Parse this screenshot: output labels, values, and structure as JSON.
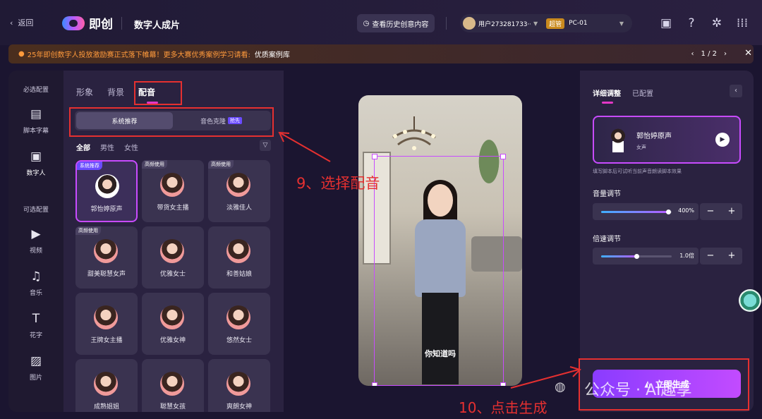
{
  "topbar": {
    "back_label": "返回",
    "logo_text": "即创",
    "page_title": "数字人成片",
    "history_button": "查看历史创意内容",
    "user": "用户273281733···",
    "super_badge": "超管",
    "device": "PC-01",
    "icons": [
      "wallet-icon",
      "help-icon",
      "settings-icon",
      "grid-icon"
    ]
  },
  "notice": {
    "text": "25年即创数字人投放激励赛正式落下帷幕！更多大赛优秀案例学习请看:",
    "link": "优质案例库",
    "pager": "1 / 2"
  },
  "leftnav": {
    "required_header": "必选配置",
    "optional_header": "可选配置",
    "items": [
      {
        "label": "脚本字幕",
        "icon": "script-icon"
      },
      {
        "label": "数字人",
        "icon": "person-icon"
      },
      {
        "label": "视频",
        "icon": "video-icon"
      },
      {
        "label": "音乐",
        "icon": "music-icon"
      },
      {
        "label": "花字",
        "icon": "text-icon"
      },
      {
        "label": "图片",
        "icon": "image-icon"
      }
    ]
  },
  "panel": {
    "tabs": [
      "形象",
      "背景",
      "配音"
    ],
    "active_tab": "配音",
    "segments": [
      "系统推荐",
      "音色克隆"
    ],
    "pilot_badge": "抢先",
    "filters": [
      "全部",
      "男性",
      "女性"
    ],
    "voices": [
      {
        "tag": "系统推荐",
        "name": "郭怡婷原声",
        "selected": true
      },
      {
        "tag": "高频使用",
        "name": "带货女主播"
      },
      {
        "tag": "高频使用",
        "name": "淡雅佳人"
      },
      {
        "tag": "高频使用",
        "name": "甜美聪慧女声"
      },
      {
        "tag": "",
        "name": "优雅女士"
      },
      {
        "tag": "",
        "name": "和善姑娘"
      },
      {
        "tag": "",
        "name": "王牌女主播"
      },
      {
        "tag": "",
        "name": "优雅女神"
      },
      {
        "tag": "",
        "name": "悠然女士"
      },
      {
        "tag": "",
        "name": "成熟姐姐"
      },
      {
        "tag": "",
        "name": "聪慧女孩"
      },
      {
        "tag": "",
        "name": "爽朗女神"
      }
    ]
  },
  "preview": {
    "subtitle": "你知道吗"
  },
  "rightpanel": {
    "tabs": [
      "详细调整",
      "已配置"
    ],
    "voice_name": "郭怡婷原声",
    "voice_gender": "女声",
    "hint": "填写脚本后可试听当前声音朗读脚本效果",
    "volume_label": "音量调节",
    "volume_value": "400%",
    "volume_level": 0.95,
    "speed_label": "倍速调节",
    "speed_value": "1.0倍",
    "speed_level": 0.5,
    "generate_button": "立即生成"
  },
  "annotations": {
    "step9": "9、选择配音",
    "step10": "10、点击生成"
  },
  "watermark": "公众号 · AI趣享",
  "colors": {
    "accent": "#c84bff",
    "annotation": "#e53030",
    "notice_text": "#ff9a3c"
  }
}
